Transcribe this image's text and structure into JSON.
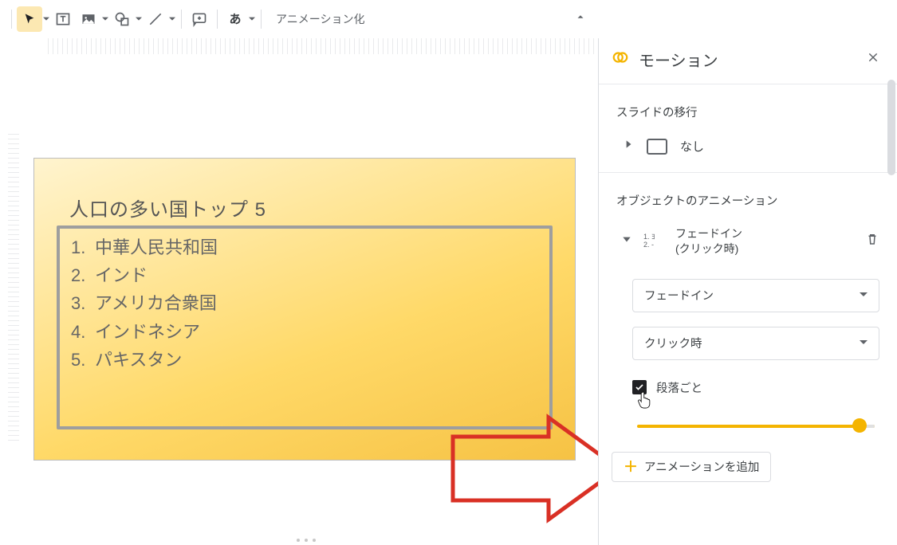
{
  "toolbar": {
    "animation_label": "アニメーション化"
  },
  "slide": {
    "title": "人口の多い国トップ 5",
    "items": [
      "中華人民共和国",
      "インド",
      "アメリカ合衆国",
      "インドネシア",
      "パキスタン"
    ]
  },
  "panel": {
    "title": "モーション",
    "section_transition": "スライドの移行",
    "transition_none": "なし",
    "section_object_anim": "オブジェクトのアニメーション",
    "anim_mini_lines": "1. ﾖ\n2. -",
    "anim_name": "フェードイン",
    "anim_trigger": "(クリック時)",
    "select_effect": "フェードイン",
    "select_trigger": "クリック時",
    "checkbox_label": "段落ごと",
    "add_button": "アニメーションを追加"
  }
}
